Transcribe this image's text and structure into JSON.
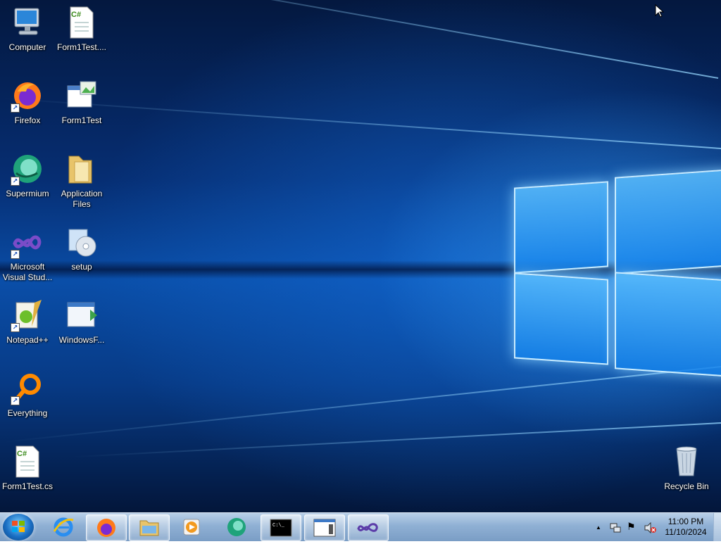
{
  "desktop": {
    "icons": [
      {
        "label": "Computer",
        "icon": "computer-icon"
      },
      {
        "label": "Form1Test....",
        "icon": "csharp-file-icon"
      },
      {
        "label": "Firefox",
        "icon": "firefox-icon"
      },
      {
        "label": "Form1Test",
        "icon": "application-icon"
      },
      {
        "label": "Supermium",
        "icon": "supermium-icon"
      },
      {
        "label": "Application Files",
        "icon": "folder-icon"
      },
      {
        "label": "Microsoft Visual Stud...",
        "icon": "visual-studio-icon"
      },
      {
        "label": "setup",
        "icon": "setup-icon"
      },
      {
        "label": "Notepad++",
        "icon": "notepadpp-icon"
      },
      {
        "label": "WindowsF...",
        "icon": "windows-app-icon"
      },
      {
        "label": "Everything",
        "icon": "everything-search-icon"
      },
      {
        "label": "Form1Test.cs",
        "icon": "csharp-file-icon"
      },
      {
        "label": "Recycle Bin",
        "icon": "recycle-bin-icon"
      }
    ]
  },
  "taskbar": {
    "start": "start-orb-icon",
    "buttons": [
      "internet-explorer-icon",
      "firefox-icon",
      "file-explorer-icon",
      "media-player-icon",
      "supermium-icon",
      "command-prompt-icon",
      "window-app-icon",
      "visual-studio-icon"
    ],
    "clock": {
      "time": "11:00 PM",
      "date": "11/10/2024"
    },
    "tray": [
      "show-hidden-icons",
      "network-icon",
      "action-center-flag-icon",
      "volume-muted-icon"
    ],
    "tray_glyphs": {
      "show_hidden": "▲",
      "flag": "⚑"
    },
    "csharp_text": "C#",
    "cmd_text": "C:\\_"
  }
}
